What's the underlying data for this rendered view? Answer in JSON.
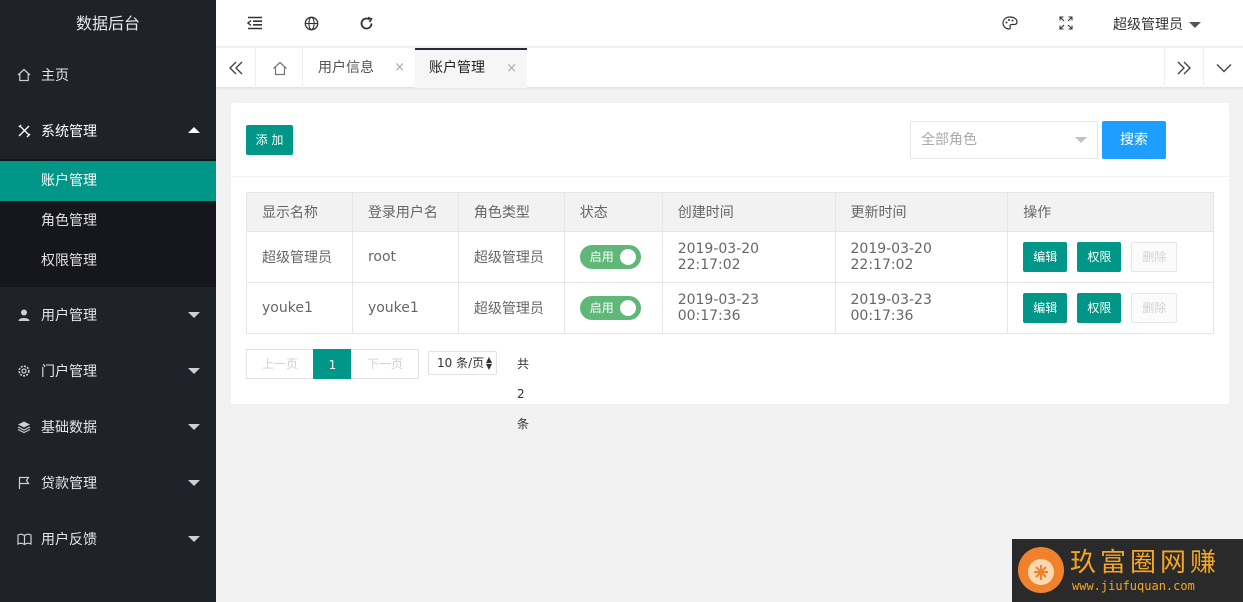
{
  "sidebar": {
    "title": "数据后台",
    "items": [
      {
        "label": "主页"
      },
      {
        "label": "系统管理",
        "children": [
          {
            "label": "账户管理"
          },
          {
            "label": "角色管理"
          },
          {
            "label": "权限管理"
          }
        ]
      },
      {
        "label": "用户管理"
      },
      {
        "label": "门户管理"
      },
      {
        "label": "基础数据"
      },
      {
        "label": "贷款管理"
      },
      {
        "label": "用户反馈"
      }
    ]
  },
  "header": {
    "user_label": "超级管理员"
  },
  "tabs": [
    {
      "label": "用户信息",
      "close": "×"
    },
    {
      "label": "账户管理",
      "close": "×"
    }
  ],
  "toolbar": {
    "add_label": "添 加",
    "role_select_placeholder": "全部角色",
    "search_label": "搜索"
  },
  "table": {
    "headers": [
      "显示名称",
      "登录用户名",
      "角色类型",
      "状态",
      "创建时间",
      "更新时间",
      "操作"
    ],
    "rows": [
      {
        "display_name": "超级管理员",
        "username": "root",
        "role": "超级管理员",
        "status": "启用",
        "created": "2019-03-20 22:17:02",
        "updated": "2019-03-20 22:17:02"
      },
      {
        "display_name": "youke1",
        "username": "youke1",
        "role": "超级管理员",
        "status": "启用",
        "created": "2019-03-23 00:17:36",
        "updated": "2019-03-23 00:17:36"
      }
    ],
    "actions": {
      "edit": "编辑",
      "perm": "权限",
      "delete": "删除"
    }
  },
  "pager": {
    "prev": "上一页",
    "current": "1",
    "next": "下一页",
    "limit": "10 条/页",
    "total": "共 2 条"
  },
  "watermark": {
    "text": "玖富圈网赚",
    "url": "www.jiufuquan.com"
  },
  "colors": {
    "sidebar_bg": "#20222a",
    "accent_green": "#009688",
    "search_blue": "#1e9fff",
    "switch_green": "#5fb878"
  }
}
